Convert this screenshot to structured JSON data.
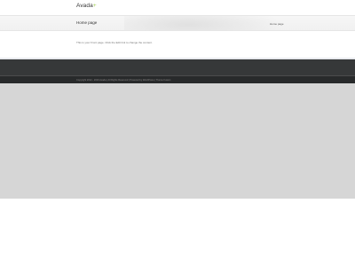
{
  "header": {
    "logo_main": "Avada",
    "logo_accent": "+"
  },
  "title_bar": {
    "page_title": "Home page",
    "breadcrumb": "Home page"
  },
  "content": {
    "text": "This is your Front page. Click the Edit link to change the content."
  },
  "footer": {
    "copyright": "Copyright 2012 - 2016 Avada | All Rights Reserved | Powered by WordPress | Theme Fusion"
  },
  "colors": {
    "accent": "#a0ce4e",
    "footer_dark": "#363839",
    "copyright_bg": "#282a2b",
    "page_bg": "#d6d6d6"
  }
}
